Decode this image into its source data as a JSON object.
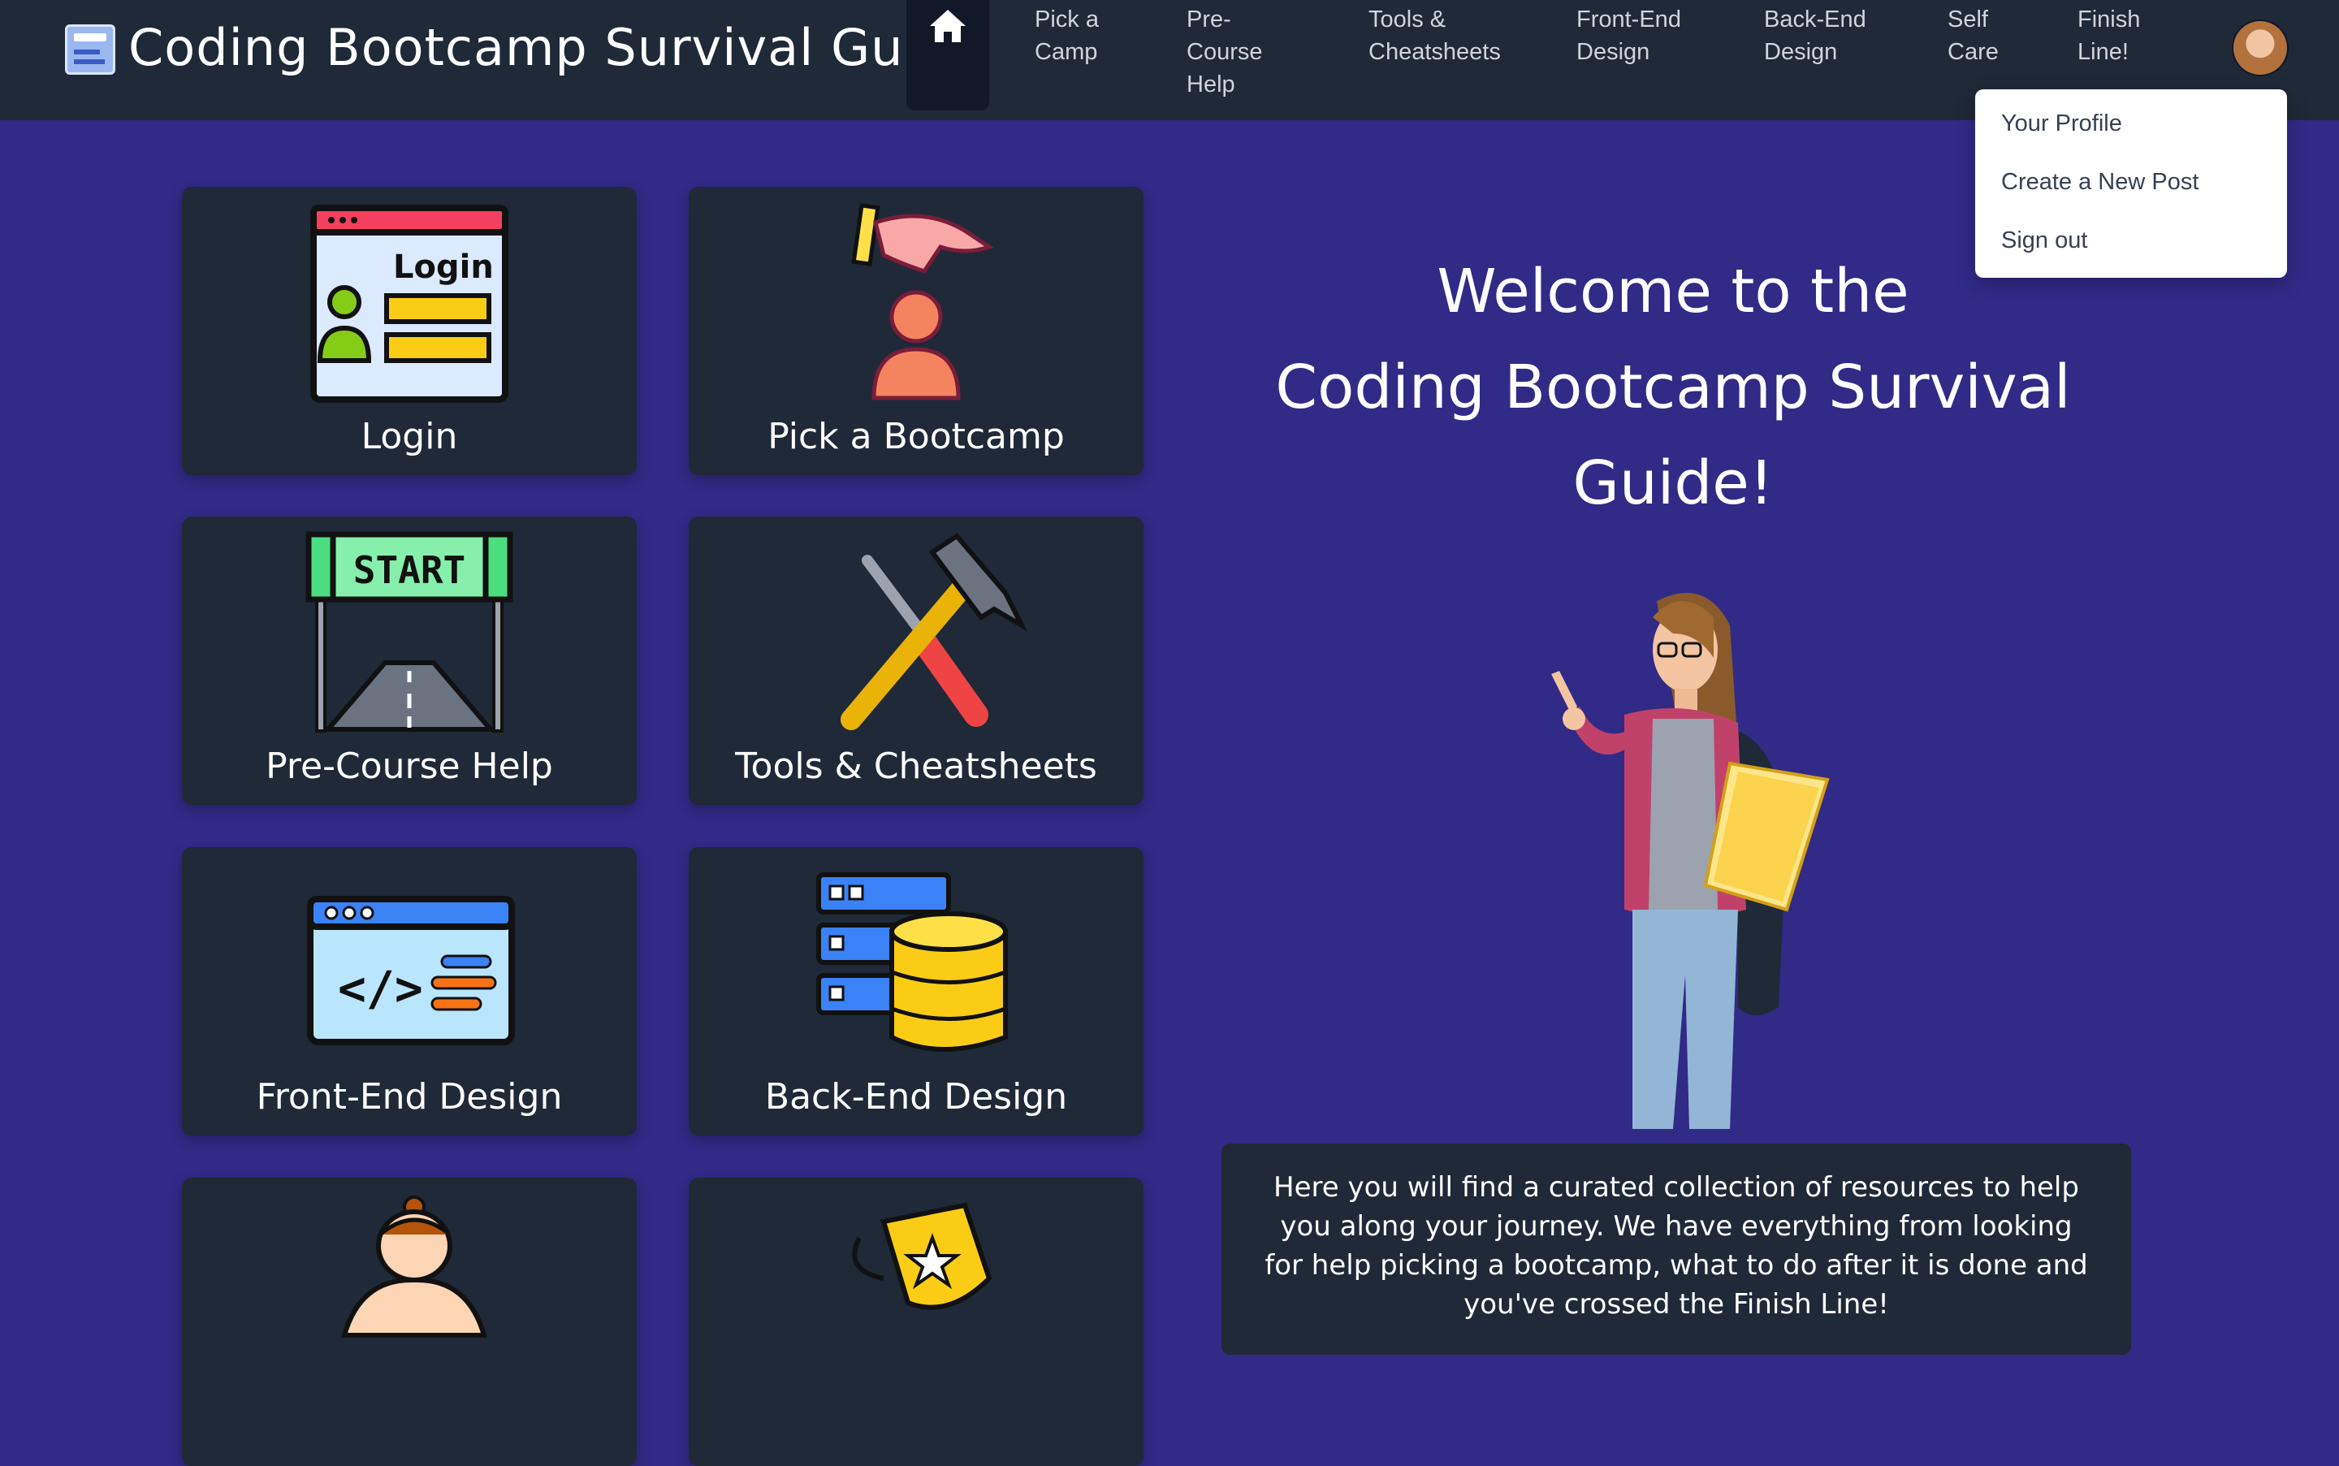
{
  "header": {
    "brand_title": "Coding Bootcamp Survival Guide",
    "nav": [
      {
        "label": "Pick a\nCamp"
      },
      {
        "label": "Pre-\nCourse\nHelp"
      },
      {
        "label": "Tools &\nCheatsheets"
      },
      {
        "label": "Front-End\nDesign"
      },
      {
        "label": "Back-End\nDesign"
      },
      {
        "label": "Self\nCare"
      },
      {
        "label": "Finish\nLine!"
      }
    ]
  },
  "profile_menu": {
    "items": [
      "Your Profile",
      "Create a New Post",
      "Sign out"
    ]
  },
  "cards": [
    {
      "label": "Login",
      "icon": "login-icon"
    },
    {
      "label": "Pick a Bootcamp",
      "icon": "pick-bootcamp-icon"
    },
    {
      "label": "Pre-Course Help",
      "icon": "start-line-icon"
    },
    {
      "label": "Tools & Cheatsheets",
      "icon": "tools-icon"
    },
    {
      "label": "Front-End Design",
      "icon": "code-window-icon"
    },
    {
      "label": "Back-End Design",
      "icon": "database-server-icon"
    },
    {
      "label": "",
      "icon": "self-care-icon"
    },
    {
      "label": "",
      "icon": "trophy-icon"
    }
  ],
  "hero": {
    "welcome_lines": [
      "Welcome to the",
      "Coding Bootcamp Survival",
      "Guide!"
    ],
    "intro": "Here you will find a curated collection of resources to help you along your journey. We have everything from looking for help picking a bootcamp, what to do after it is done and you've crossed the Finish Line!"
  },
  "colors": {
    "page_background": "#312a87",
    "nav_background": "#1f2937",
    "card_background": "#1f2937"
  }
}
